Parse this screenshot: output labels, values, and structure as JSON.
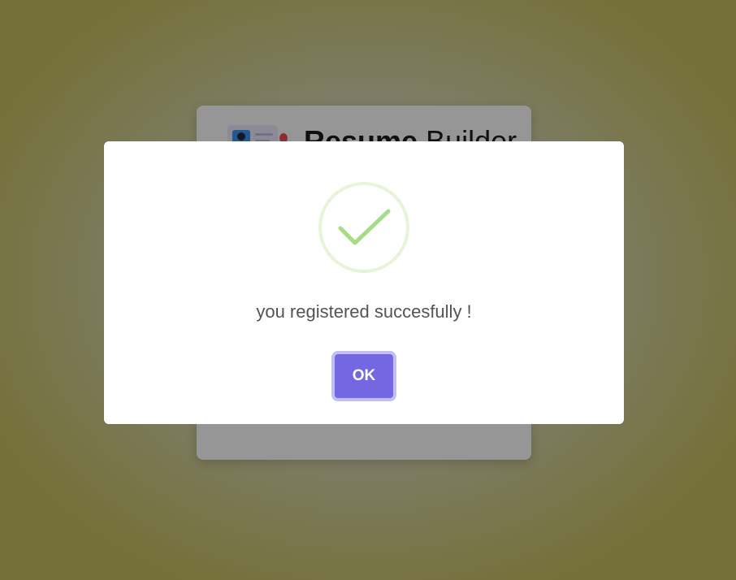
{
  "background_card": {
    "brand_title_bold": "Resume",
    "brand_title_light": " Builder",
    "link_left": "",
    "link_right": ""
  },
  "modal": {
    "icon": "check-circle-icon",
    "message": "you registered succesfully !",
    "ok_label": "OK"
  },
  "colors": {
    "accent": "#7367e2",
    "success": "#a5dc86",
    "overlay_tint": "#bdb55c"
  }
}
